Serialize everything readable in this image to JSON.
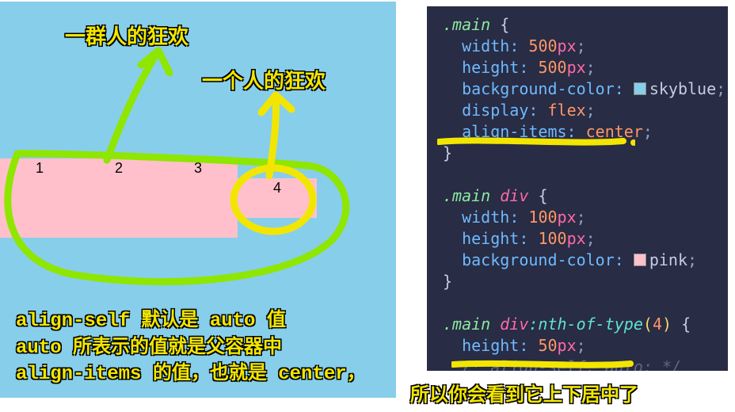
{
  "left": {
    "label_group": "一群人的狂欢",
    "label_single": "一个人的狂欢",
    "items": [
      "1",
      "2",
      "3",
      "4"
    ],
    "caption_line1": "align-self 默认是 auto 值",
    "caption_line2": "auto 所表示的值就是父容器中",
    "caption_line3_a": "align-items 的值，也就是 center，",
    "caption_line3_b": "所以你会看到它上下居中了"
  },
  "code": {
    "rule1_selector": ".main",
    "rule1": {
      "width_prop": "width",
      "width_num": "500",
      "width_unit": "px",
      "height_prop": "height",
      "height_num": "500",
      "height_unit": "px",
      "bg_prop": "background-color",
      "bg_val": "skyblue",
      "bg_swatch": "#87ceeb",
      "display_prop": "display",
      "display_val": "flex",
      "align_prop": "align-items",
      "align_val": "center"
    },
    "rule2_selector_class": ".main",
    "rule2_selector_tag": "div",
    "rule2": {
      "width_prop": "width",
      "width_num": "100",
      "width_unit": "px",
      "height_prop": "height",
      "height_num": "100",
      "height_unit": "px",
      "bg_prop": "background-color",
      "bg_val": "pink",
      "bg_swatch": "#ffc0cb"
    },
    "rule3_selector_class": ".main",
    "rule3_selector_tag": "div",
    "rule3_pseudo": ":nth-of-type",
    "rule3_arg": "4",
    "rule3": {
      "height_prop": "height",
      "height_num": "50",
      "height_unit": "px",
      "comment": "/* align-self: auto; */"
    }
  }
}
